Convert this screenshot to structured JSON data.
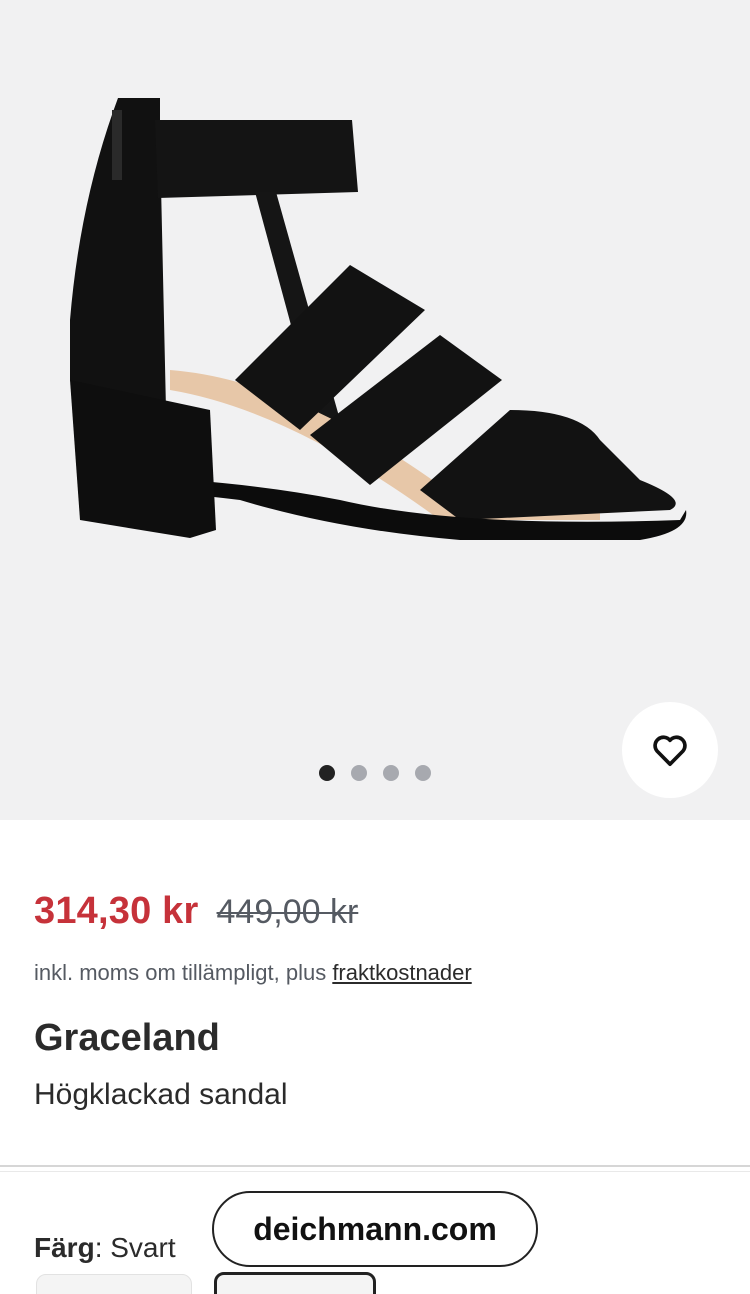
{
  "gallery": {
    "image_count": 4,
    "active_index": 0
  },
  "product": {
    "price_current": "314,30 kr",
    "price_original": "449,00 kr",
    "tax_note": "inkl. moms om tillämpligt, plus",
    "shipping_link": "fraktkostnader",
    "brand": "Graceland",
    "subtitle": "Högklackad sandal"
  },
  "color": {
    "label": "Färg",
    "value": "Svart"
  },
  "browser": {
    "url": "deichmann.com"
  },
  "colors": {
    "sale_price": "#c6323a",
    "gallery_bg": "#f1f1f2",
    "text": "#2b2b2b"
  },
  "icons": {
    "wishlist": "heart-outline-icon"
  }
}
